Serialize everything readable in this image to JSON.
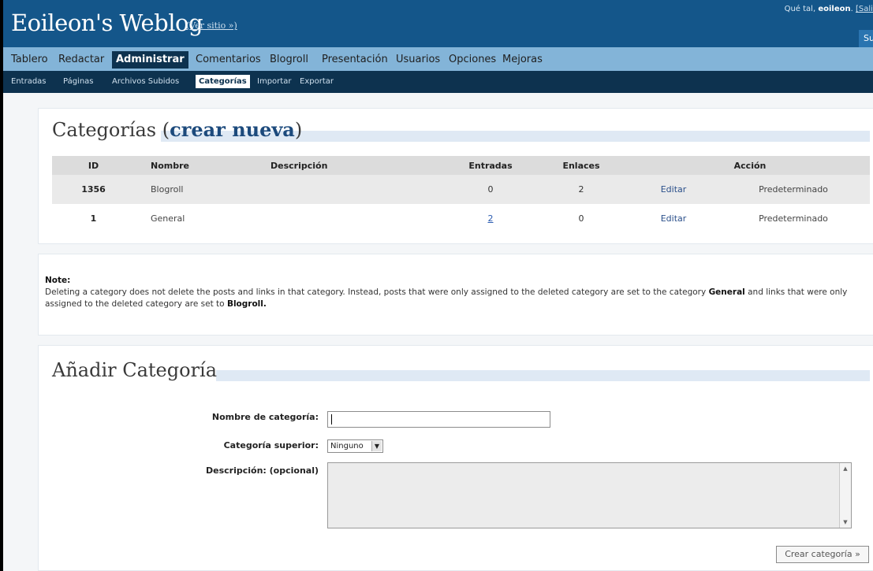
{
  "header": {
    "blog_title": "Eoileon's Weblog",
    "view_site": "(Ver sitio »)",
    "greeting_prefix": "Qué tal,",
    "username": "eoileon",
    "logout": "[Salir",
    "corner_button": "Su"
  },
  "menu": {
    "items": [
      "Tablero",
      "Redactar",
      "Administrar",
      "Comentarios",
      "Blogroll",
      "Presentación",
      "Usuarios",
      "Opciones",
      "Mejoras"
    ],
    "current": "Administrar"
  },
  "submenu": {
    "items": [
      "Entradas",
      "Páginas",
      "Archivos Subidos",
      "Categorías",
      "Importar",
      "Exportar"
    ],
    "current": "Categorías"
  },
  "categories": {
    "title": "Categorías",
    "create_new": "crear nueva",
    "columns": [
      "ID",
      "Nombre",
      "Descripción",
      "Entradas",
      "Enlaces",
      "Acción"
    ],
    "rows": [
      {
        "id": "1356",
        "name": "Blogroll",
        "description": "",
        "posts": "0",
        "links": "2",
        "edit": "Editar",
        "action": "Predeterminado"
      },
      {
        "id": "1",
        "name": "General",
        "description": "",
        "posts": "2",
        "links": "0",
        "edit": "Editar",
        "action": "Predeterminado"
      }
    ]
  },
  "note": {
    "label": "Note",
    "text_1": "Deleting a category does not delete the posts and links in that category. Instead, posts that were only assigned to the deleted category are set to the category",
    "general": "General",
    "text_2": "and links that were only assigned to the deleted category are set to",
    "blogroll": "Blogroll."
  },
  "add_category": {
    "title": "Añadir Categoría",
    "name_label": "Nombre de categoría:",
    "name_value": "",
    "parent_label": "Categoría superior:",
    "parent_selected": "Ninguno",
    "description_label": "Descripción: (opcional)",
    "description_value": "",
    "submit": "Crear categoría »"
  },
  "colors": {
    "header_bg": "#14568a",
    "menu_bg": "#83b4d8",
    "submenu_bg": "#0d324f",
    "accent_line": "#dfe9f4"
  }
}
